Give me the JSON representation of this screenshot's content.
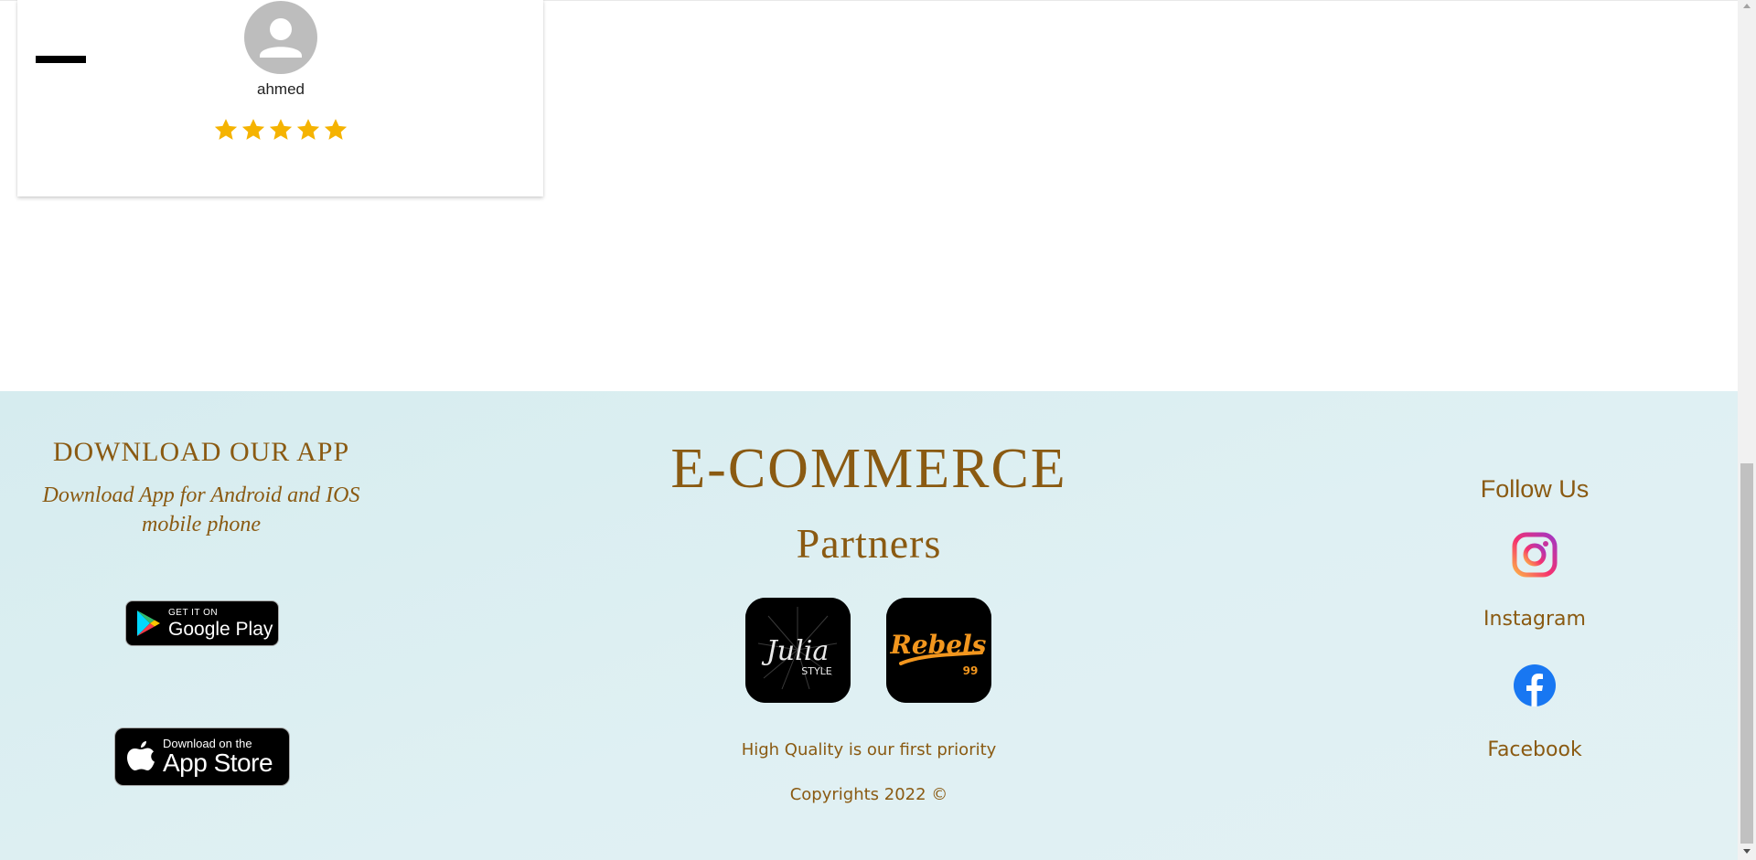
{
  "review": {
    "reviewer_name": "ahmed",
    "rating": 5,
    "rating_max": 5,
    "star_color": "#f5b301"
  },
  "footer": {
    "download": {
      "title": "DOWNLOAD OUR APP",
      "subtitle": "Download App for Android and IOS mobile phone",
      "google_play": {
        "small": "GET IT ON",
        "big": "Google Play"
      },
      "app_store": {
        "small": "Download on the",
        "big": "App Store"
      }
    },
    "brand": "E-COMMERCE",
    "partners": {
      "title": "Partners",
      "items": [
        {
          "name": "Julia",
          "sub": "STYLE"
        },
        {
          "name": "Rebels",
          "sub": "99"
        }
      ]
    },
    "tagline": "High Quality is our first priority",
    "copyright": "Copyrights 2022 ©",
    "social": {
      "title": "Follow Us",
      "instagram": "Instagram",
      "facebook": "Facebook"
    }
  },
  "colors": {
    "text_brown": "#8a5a12",
    "footer_bg": "#dcedf0",
    "facebook_blue": "#1877f2"
  }
}
